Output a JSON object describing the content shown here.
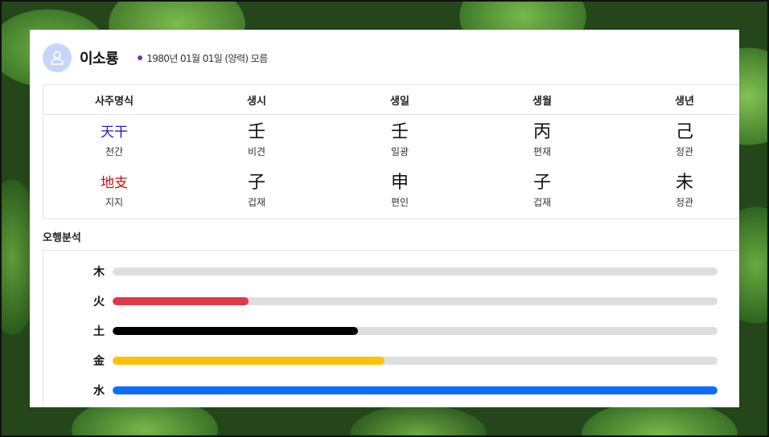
{
  "profile": {
    "name": "이소룡",
    "birth_info": "1980년 01월 01일 (양력) 모름"
  },
  "saju": {
    "headers": [
      "사주명식",
      "생시",
      "생일",
      "생월",
      "생년"
    ],
    "cheongan_label": "天干",
    "cheongan_sub": "천간",
    "jiji_label": "地支",
    "jiji_sub": "지지",
    "cheongan": [
      {
        "char": "壬",
        "sub": "비견"
      },
      {
        "char": "壬",
        "sub": "일광"
      },
      {
        "char": "丙",
        "sub": "편재"
      },
      {
        "char": "己",
        "sub": "정관"
      }
    ],
    "jiji": [
      {
        "char": "子",
        "sub": "겁재"
      },
      {
        "char": "申",
        "sub": "편인"
      },
      {
        "char": "子",
        "sub": "겁재"
      },
      {
        "char": "未",
        "sub": "정관"
      }
    ],
    "colors": {
      "cheongan": "#1f1fbf",
      "jiji": "#d10a0a"
    }
  },
  "analysis": {
    "title": "오행분석",
    "elements": [
      {
        "label": "木",
        "percent": 0,
        "color": "#7bbf3a"
      },
      {
        "label": "火",
        "percent": 22.5,
        "color": "#e0384a"
      },
      {
        "label": "土",
        "percent": 40.5,
        "color": "#000000"
      },
      {
        "label": "金",
        "percent": 45,
        "color": "#ffc107"
      },
      {
        "label": "水",
        "percent": 100,
        "color": "#0d6efd"
      }
    ]
  }
}
